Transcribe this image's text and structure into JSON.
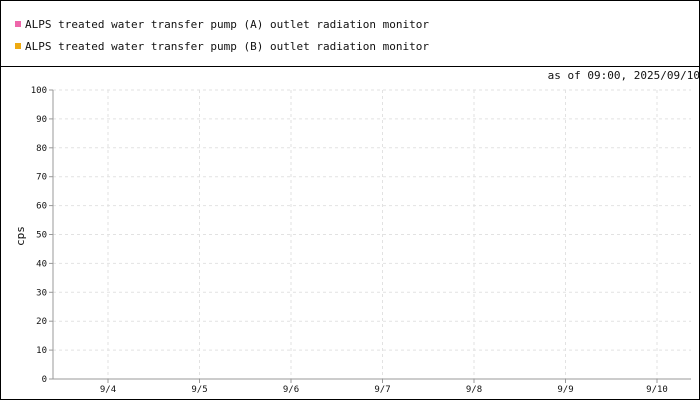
{
  "chart_data": {
    "type": "line",
    "ylabel": "cps",
    "xlabel": "",
    "ylim": [
      0,
      100
    ],
    "yticks": [
      0,
      10,
      20,
      30,
      40,
      50,
      60,
      70,
      80,
      90,
      100
    ],
    "categories": [
      "9/4",
      "9/5",
      "9/6",
      "9/7",
      "9/8",
      "9/9",
      "9/10"
    ],
    "annotation": "as of 09:00, 2025/09/10",
    "grid": true,
    "legend_position": "top",
    "series": [
      {
        "name": "ALPS treated water transfer pump (A) outlet radiation monitor",
        "color": "#ee66aa",
        "values": []
      },
      {
        "name": "ALPS treated water transfer pump (B) outlet radiation monitor",
        "color": "#eeaa11",
        "values": []
      }
    ]
  }
}
